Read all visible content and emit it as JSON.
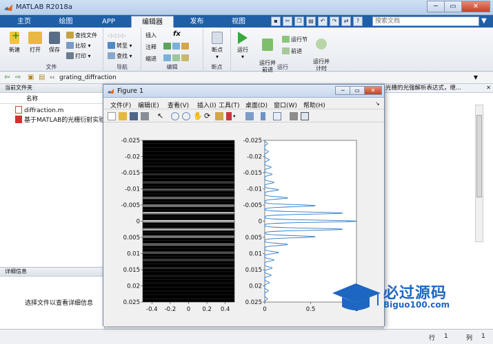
{
  "app": {
    "title": "MATLAB R2018a",
    "window_buttons": [
      "─",
      "▭",
      "✕"
    ]
  },
  "tabs": [
    {
      "label": "主页"
    },
    {
      "label": "绘图"
    },
    {
      "label": "APP"
    },
    {
      "label": "编辑器"
    },
    {
      "label": "发布"
    },
    {
      "label": "视图"
    }
  ],
  "search": {
    "placeholder": "搜索文档"
  },
  "ribbon": {
    "file_group": {
      "label": "文件",
      "new": "新建",
      "open": "打开",
      "save": "保存",
      "find_files": "查找文件",
      "compare": "比较",
      "print": "打印"
    },
    "nav_group": {
      "label": "导航",
      "goto": "转至",
      "find": "查找"
    },
    "edit_group": {
      "label": "编辑",
      "insert": "插入",
      "comment": "注释",
      "indent": "缩进",
      "fx": "fx"
    },
    "breakpoint_group": {
      "label": "断点",
      "breakpoints": "断点"
    },
    "run_group": {
      "label": "运行",
      "run": "运行",
      "run_advance": "运行并\n前进",
      "run_section": "运行节",
      "advance": "前进",
      "run_time": "运行并\n计时"
    }
  },
  "address": {
    "path": "grating_diffraction"
  },
  "left_panel": {
    "header": "当前文件夹",
    "column": "名称",
    "files": [
      {
        "name": "diffraction.m"
      },
      {
        "name": "基于MATLAB的光栅衍射实验..."
      }
    ],
    "details_header": "详细信息",
    "details_text": "选择文件以查看详细信息"
  },
  "right_panel": {
    "top_text": "光栅的光强解析表达式，继..."
  },
  "figure": {
    "title": "Figure 1",
    "menu": [
      "文件(F)",
      "编辑(E)",
      "查看(V)",
      "插入(I)",
      "工具(T)",
      "桌面(D)",
      "窗口(W)",
      "帮助(H)"
    ],
    "left_yticks": [
      "-0.025",
      "-0.02",
      "-0.015",
      "-0.01",
      "-0.005",
      "0",
      "0.005",
      "0.01",
      "0.015",
      "0.02",
      "0.025"
    ],
    "left_xticks": [
      "-0.4",
      "-0.2",
      "0",
      "0.2",
      "0.4"
    ],
    "right_yticks": [
      "-0.025",
      "-0.02",
      "-0.015",
      "-0.01",
      "-0.005",
      "0",
      "0.005",
      "0.01",
      "0.015",
      "0.02",
      "0.025"
    ],
    "right_xticks": [
      "0",
      "0.5",
      "1"
    ]
  },
  "chart_data": [
    {
      "type": "heatmap",
      "colormap": "gray",
      "xlim": [
        -0.5,
        0.5
      ],
      "ylim": [
        -0.025,
        0.025
      ],
      "yreversed": true,
      "x_ticks": [
        -0.4,
        -0.2,
        0,
        0.2,
        0.4
      ],
      "y_ticks": [
        -0.025,
        -0.02,
        -0.015,
        -0.01,
        -0.005,
        0,
        0.005,
        0.01,
        0.015,
        0.02,
        0.025
      ],
      "bright_fringes_y": [
        -0.0025,
        0,
        0.0025,
        -0.0048,
        0.0048,
        -0.0072,
        0.0072,
        -0.0097,
        0.0097,
        -0.012,
        0.012,
        -0.0145,
        0.0145,
        -0.017,
        0.017,
        -0.019,
        0.019
      ]
    },
    {
      "type": "line",
      "x_label_ticks": [
        0,
        0.5,
        1
      ],
      "xlim": [
        0,
        1
      ],
      "ylim": [
        -0.025,
        0.025
      ],
      "yreversed": true,
      "series": [
        {
          "peaks_y": [
            -0.024,
            -0.0215,
            -0.019,
            -0.0167,
            -0.0145,
            -0.012,
            -0.0097,
            -0.0072,
            -0.0048,
            -0.0025,
            0,
            0.0025,
            0.0048,
            0.0072,
            0.0097,
            0.012,
            0.0145,
            0.0167,
            0.019,
            0.0215,
            0.024
          ],
          "peaks_x": [
            0.03,
            0.04,
            0.05,
            0.07,
            0.08,
            0.1,
            0.15,
            0.25,
            0.55,
            0.85,
            1.0,
            0.85,
            0.55,
            0.25,
            0.15,
            0.1,
            0.08,
            0.07,
            0.05,
            0.04,
            0.03
          ]
        }
      ]
    }
  ],
  "status": {
    "row_label": "行",
    "row": "1",
    "col_label": "列",
    "col": "1"
  },
  "watermark": {
    "cn": "必过源码",
    "en": "Biguo100.com"
  },
  "colors": {
    "tab_blue": "#1f5fa8",
    "accent": "#1d66c2",
    "plot_line": "#2a78c8"
  }
}
